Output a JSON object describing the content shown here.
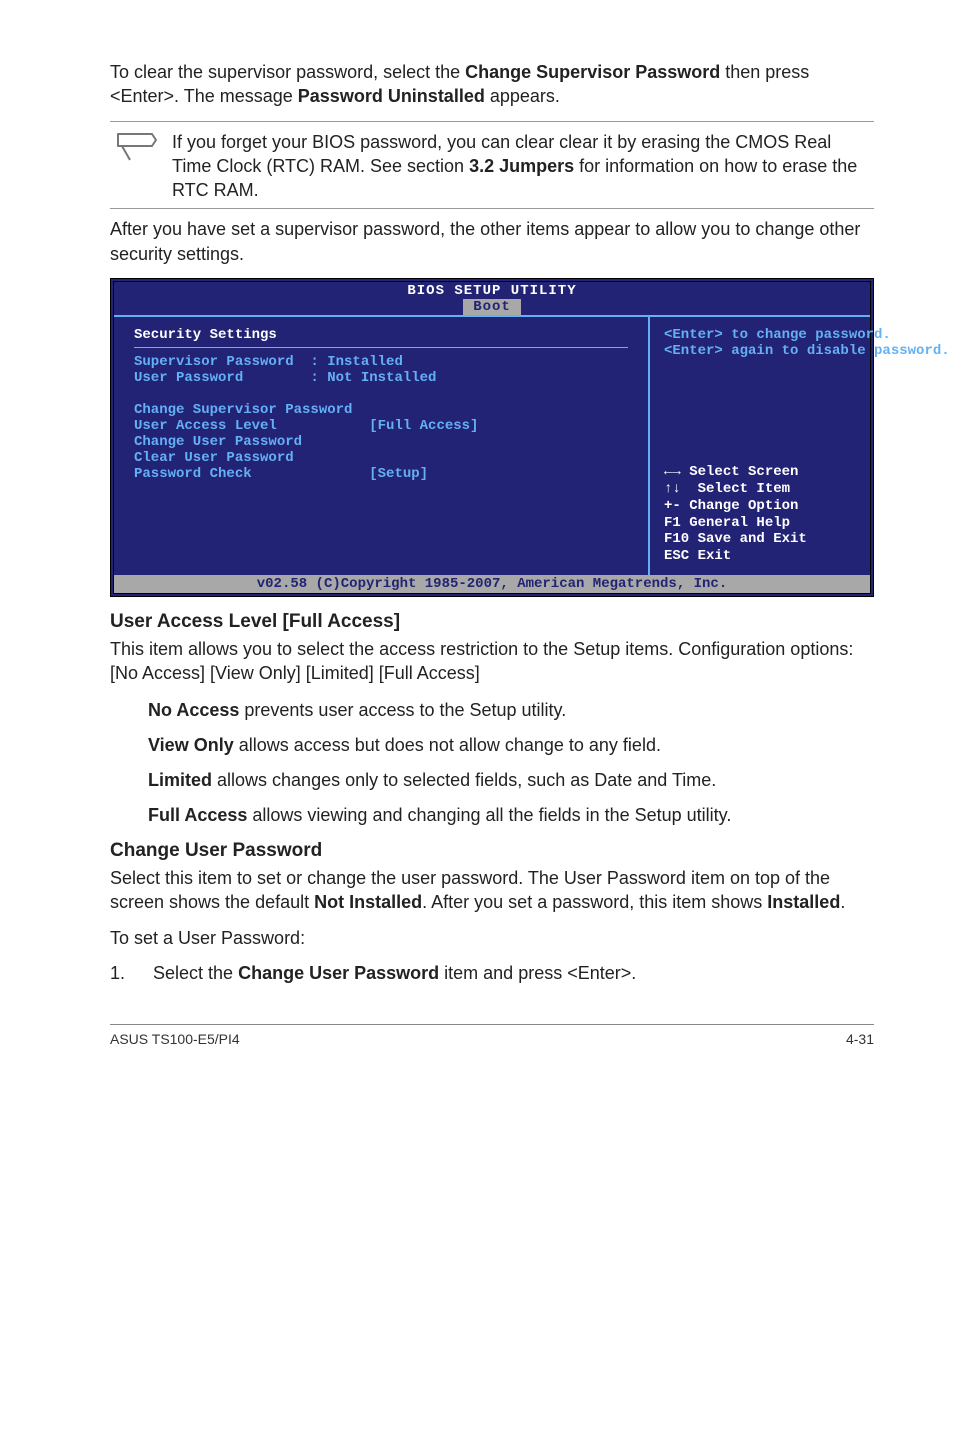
{
  "para1_pre": "To clear the supervisor password, select the ",
  "para1_b1": "Change Supervisor Password",
  "para1_mid": " then press <Enter>. The message ",
  "para1_b2": "Password Uninstalled",
  "para1_post": " appears.",
  "note_pre": "If you forget your BIOS password, you can clear clear it by erasing the CMOS Real Time Clock (RTC) RAM. See section ",
  "note_b": "3.2 Jumpers",
  "note_post": " for information on how to erase the RTC RAM.",
  "para2": "After you have set a supervisor password, the other items appear to allow you to change other security settings.",
  "bios": {
    "title": "BIOS SETUP UTILITY",
    "tab": "Boot",
    "sectitle": "Security Settings",
    "row_sup": "Supervisor Password  : Installed",
    "row_user": "User Password        : Not Installed",
    "row_csp": "Change Supervisor Password",
    "row_ual": "User Access Level           [Full Access]",
    "row_cup": "Change User Password",
    "row_clr": "Clear User Password",
    "row_pwc": "Password Check              [Setup]",
    "help1": "<Enter> to change password.",
    "help2": "<Enter> again to disable password.",
    "keys_sel": "Select Screen",
    "keys_item": "Select Item",
    "keys_chg": "+-  Change Option",
    "keys_f1": "F1  General Help",
    "keys_f10": "F10 Save and Exit",
    "keys_esc": "ESC Exit",
    "foot": "v02.58 (C)Copyright 1985-2007, American Megatrends, Inc."
  },
  "h_ual": "User Access Level [Full Access]",
  "ual_p": "This item allows you to select the access restriction to the Setup items. Configuration options: [No Access] [View Only] [Limited] [Full Access]",
  "na_b": "No Access",
  "na_t": " prevents user access to the Setup utility.",
  "vo_b": "View Only",
  "vo_t": " allows access but does not allow change to any field.",
  "li_b": "Limited",
  "li_t": " allows changes only to selected fields, such as Date and Time.",
  "fa_b": "Full Access",
  "fa_t": " allows viewing and changing all the fields in the Setup utility.",
  "h_cup": "Change User Password",
  "cup_p_pre": "Select this item to set or change the user password. The User Password item on top of the screen shows the default ",
  "cup_p_b1": "Not Installed",
  "cup_p_mid": ". After you set a password, this item shows ",
  "cup_p_b2": "Installed",
  "cup_p_post": ".",
  "touser": "To set a User Password:",
  "ol1_num": "1.",
  "ol1_pre": "Select the ",
  "ol1_b": "Change User Password",
  "ol1_post": " item and press <Enter>.",
  "foot_l": "ASUS TS100-E5/PI4",
  "foot_r": "4-31"
}
